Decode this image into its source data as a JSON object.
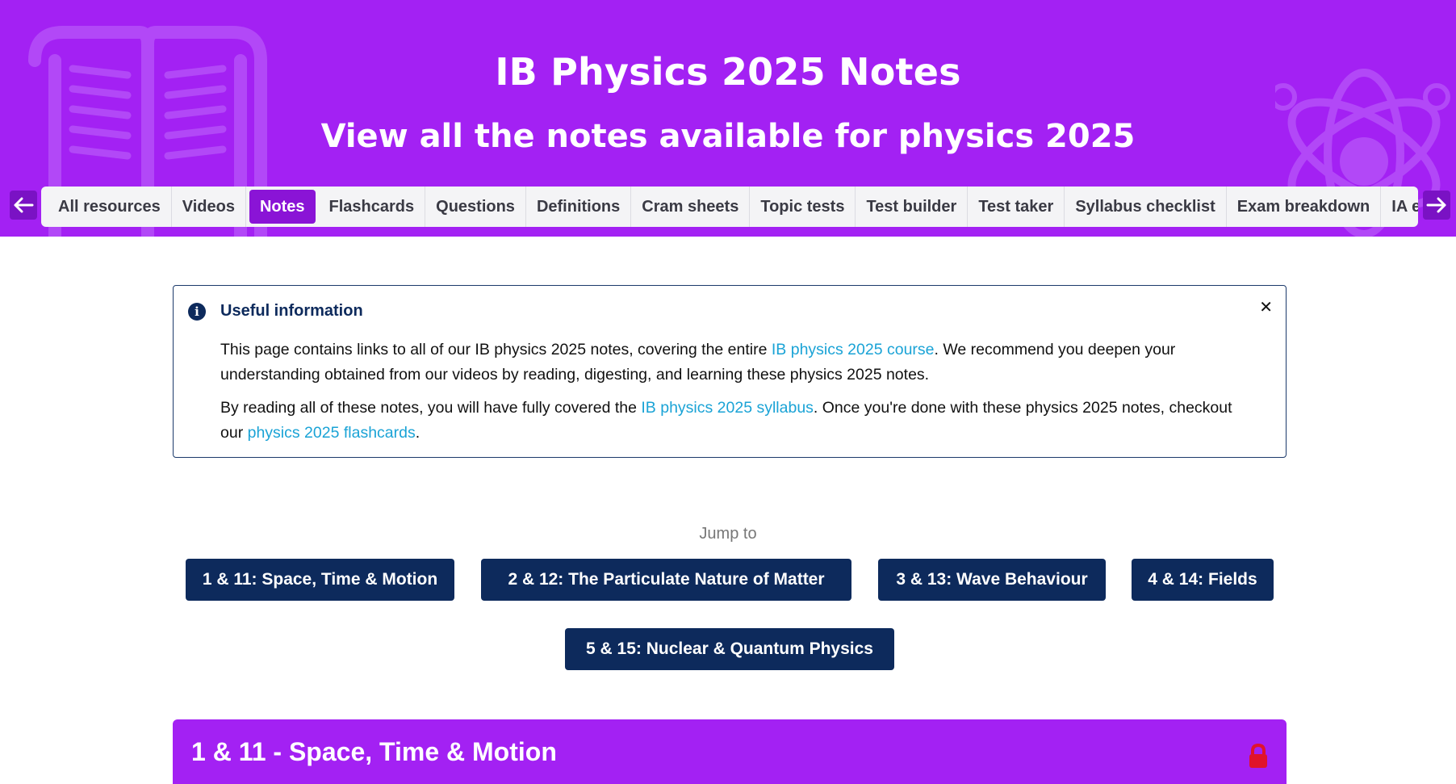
{
  "hero": {
    "title": "IB Physics 2025 Notes",
    "subtitle": "View all the notes available for physics 2025",
    "background_color": "#a321f3"
  },
  "tabs": [
    {
      "label": "All resources",
      "active": false
    },
    {
      "label": "Videos",
      "active": false
    },
    {
      "label": "Notes",
      "active": true
    },
    {
      "label": "Flashcards",
      "active": false
    },
    {
      "label": "Questions",
      "active": false
    },
    {
      "label": "Definitions",
      "active": false
    },
    {
      "label": "Cram sheets",
      "active": false
    },
    {
      "label": "Topic tests",
      "active": false
    },
    {
      "label": "Test builder",
      "active": false
    },
    {
      "label": "Test taker",
      "active": false
    },
    {
      "label": "Syllabus checklist",
      "active": false
    },
    {
      "label": "Exam breakdown",
      "active": false
    },
    {
      "label": "IA ex",
      "active": false
    }
  ],
  "nav_arrows": {
    "left_icon": "arrow-left-icon",
    "right_icon": "arrow-right-icon"
  },
  "info": {
    "title": "Useful information",
    "icon": "info-icon",
    "close_icon": "close-icon",
    "p1_a": "This page contains links to all of our IB physics 2025 notes, covering the entire ",
    "p1_link": "IB physics 2025 course",
    "p1_b": ". We recommend you deepen your understanding obtained from our videos by reading, digesting, and learning these physics 2025 notes.",
    "p2_a": "By reading all of these notes, you will have fully covered the ",
    "p2_link1": "IB physics 2025 syllabus",
    "p2_b": ". Once you're done with these physics 2025 notes, checkout our ",
    "p2_link2": "physics 2025 flashcards",
    "p2_c": "."
  },
  "jump": {
    "label": "Jump to",
    "buttons": [
      "1 & 11: Space, Time & Motion",
      "2 & 12: The Particulate Nature of Matter",
      "3 & 13: Wave Behaviour",
      "4 & 14: Fields",
      "5 & 15: Nuclear & Quantum Physics"
    ]
  },
  "section": {
    "title": "1 & 11 - Space, Time & Motion",
    "lock_icon": "lock-icon"
  },
  "colors": {
    "primary_purple": "#a321f3",
    "active_tab": "#8a14d6",
    "navy": "#0d2a5c",
    "link": "#1aa3d6",
    "lock_red": "#e0132b"
  }
}
